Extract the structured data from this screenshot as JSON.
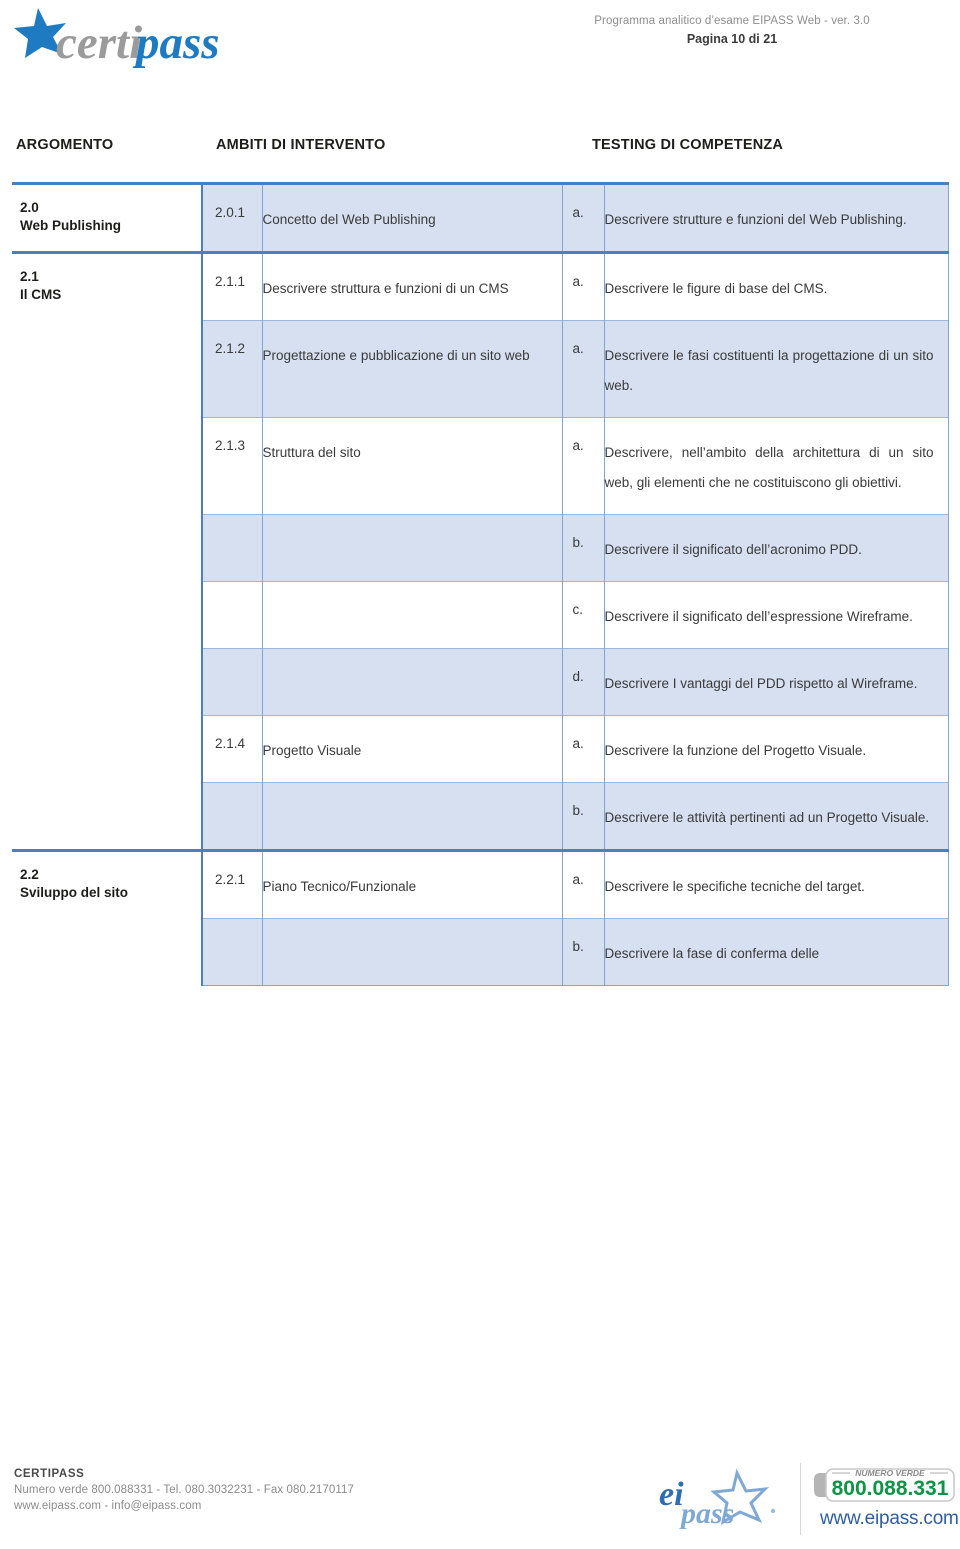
{
  "header": {
    "brand_gray": "certi",
    "brand_blue": "pass",
    "document_title": "Programma analitico d’esame EIPASS Web - ver. 3.0",
    "page_indicator": "Pagina 10 di 21"
  },
  "columns": {
    "argomento": "ARGOMENTO",
    "ambiti": "AMBITI DI INTERVENTO",
    "testing": "TESTING DI COMPETENZA"
  },
  "colors": {
    "rule_blue": "#4C7FC0",
    "thin_border_blue": "#7FA5D4",
    "row_shade": "#D6E0F0",
    "brand_blue": "#1F7BC1",
    "brand_gray": "#9B9B9B",
    "footer_green": "#0E9444",
    "footer_web_blue": "#2E5F9E"
  },
  "sections": [
    {
      "topic_number": "2.0",
      "topic_name": "Web Publishing",
      "rows": [
        {
          "number": "2.0.1",
          "area": "Concetto del Web Publishing",
          "letter": "a.",
          "test": "Descrivere strutture e funzioni del Web Publishing.",
          "shade": true
        }
      ]
    },
    {
      "topic_number": "2.1",
      "topic_name": "Il CMS",
      "rows": [
        {
          "number": "2.1.1",
          "area": "Descrivere struttura e funzioni di un CMS",
          "letter": "a.",
          "test": "Descrivere le figure di base del CMS.",
          "shade": false
        },
        {
          "number": "2.1.2",
          "area": "Progettazione e pubblicazione di un sito web",
          "letter": "a.",
          "test": "Descrivere le fasi costituenti la progettazione di un sito web.",
          "shade": true
        },
        {
          "number": "2.1.3",
          "area": "Struttura del sito",
          "letter": "a.",
          "test": "Descrivere, nell’ambito della architettura di un sito web, gli elementi che ne costituiscono gli obiettivi.",
          "shade": false
        },
        {
          "number": "",
          "area": "",
          "letter": "b.",
          "test": "Descrivere il significato dell’acronimo PDD.",
          "shade": true
        },
        {
          "number": "",
          "area": "",
          "letter": "c.",
          "test": "Descrivere il significato dell’espressione Wireframe.",
          "shade": false
        },
        {
          "number": "",
          "area": "",
          "letter": "d.",
          "test": "Descrivere I vantaggi del PDD rispetto al Wireframe.",
          "shade": true
        },
        {
          "number": "2.1.4",
          "area": "Progetto Visuale",
          "letter": "a.",
          "test": "Descrivere la funzione del Progetto Visuale.",
          "shade": false
        },
        {
          "number": "",
          "area": "",
          "letter": "b.",
          "test": "Descrivere le attività pertinenti ad un Progetto Visuale.",
          "shade": true
        }
      ]
    },
    {
      "topic_number": "2.2",
      "topic_name": "Sviluppo del sito",
      "rows": [
        {
          "number": "2.2.1",
          "area": "Piano Tecnico/Funzionale",
          "letter": "a.",
          "test": "Descrivere le specifiche tecniche del target.",
          "shade": false
        },
        {
          "number": "",
          "area": "",
          "letter": "b.",
          "test": "Descrivere la fase di conferma delle",
          "shade": true
        }
      ]
    }
  ],
  "footer": {
    "org_name": "CERTIPASS",
    "contact_line": "Numero verde 800.088331 - Tel. 080.3032231 - Fax 080.2170117",
    "web_line": "www.eipass.com - info@eipass.com",
    "logo_ei": "ei",
    "logo_pass": "pass",
    "numero_verde_label": "NUMERO VERDE",
    "numero_verde_value": "800.088.331",
    "website": "www.eipass.com"
  }
}
